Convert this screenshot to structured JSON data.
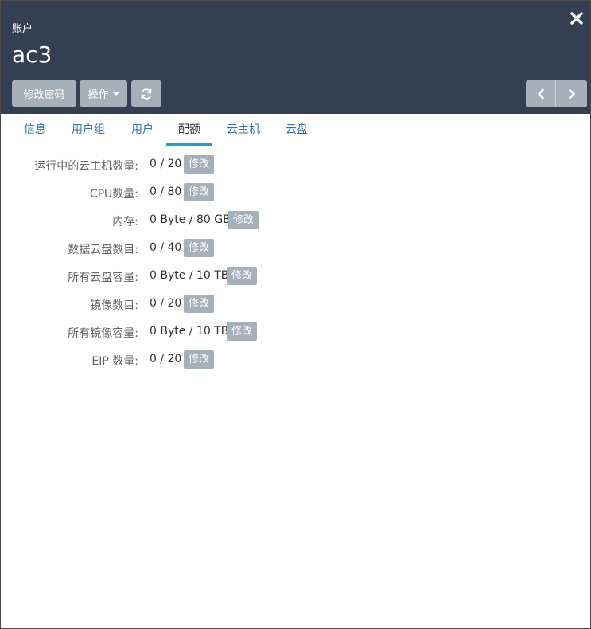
{
  "header": {
    "subtitle": "账户",
    "title": "ac3",
    "change_password_label": "修改密码",
    "actions_label": "操作"
  },
  "tabs": [
    {
      "label": "信息"
    },
    {
      "label": "用户组"
    },
    {
      "label": "用户"
    },
    {
      "label": "配额",
      "active": true
    },
    {
      "label": "云主机"
    },
    {
      "label": "云盘"
    }
  ],
  "quota": [
    {
      "label": "运行中的云主机数量:",
      "value": "0 / 20",
      "action": "修改"
    },
    {
      "label": "CPU数量:",
      "value": "0 / 80",
      "action": "修改"
    },
    {
      "label": "内存:",
      "value": "0 Byte / 80 GB",
      "action": "修改"
    },
    {
      "label": "数据云盘数目:",
      "value": "0 / 40",
      "action": "修改"
    },
    {
      "label": "所有云盘容量:",
      "value": "0 Byte / 10 TB",
      "action": "修改"
    },
    {
      "label": "镜像数目:",
      "value": "0 / 20",
      "action": "修改"
    },
    {
      "label": "所有镜像容量:",
      "value": "0 Byte / 10 TB",
      "action": "修改"
    },
    {
      "label": "EIP 数量:",
      "value": "0 / 20",
      "action": "修改"
    }
  ],
  "colors": {
    "header_bg": "#343f52",
    "button_bg": "#a6b0bb",
    "tab_link": "#2a76ad",
    "tab_underline": "#1e9ed8"
  },
  "icons": [
    "close-icon",
    "refresh-icon",
    "chevron-left-icon",
    "chevron-right-icon",
    "caret-down-icon"
  ]
}
